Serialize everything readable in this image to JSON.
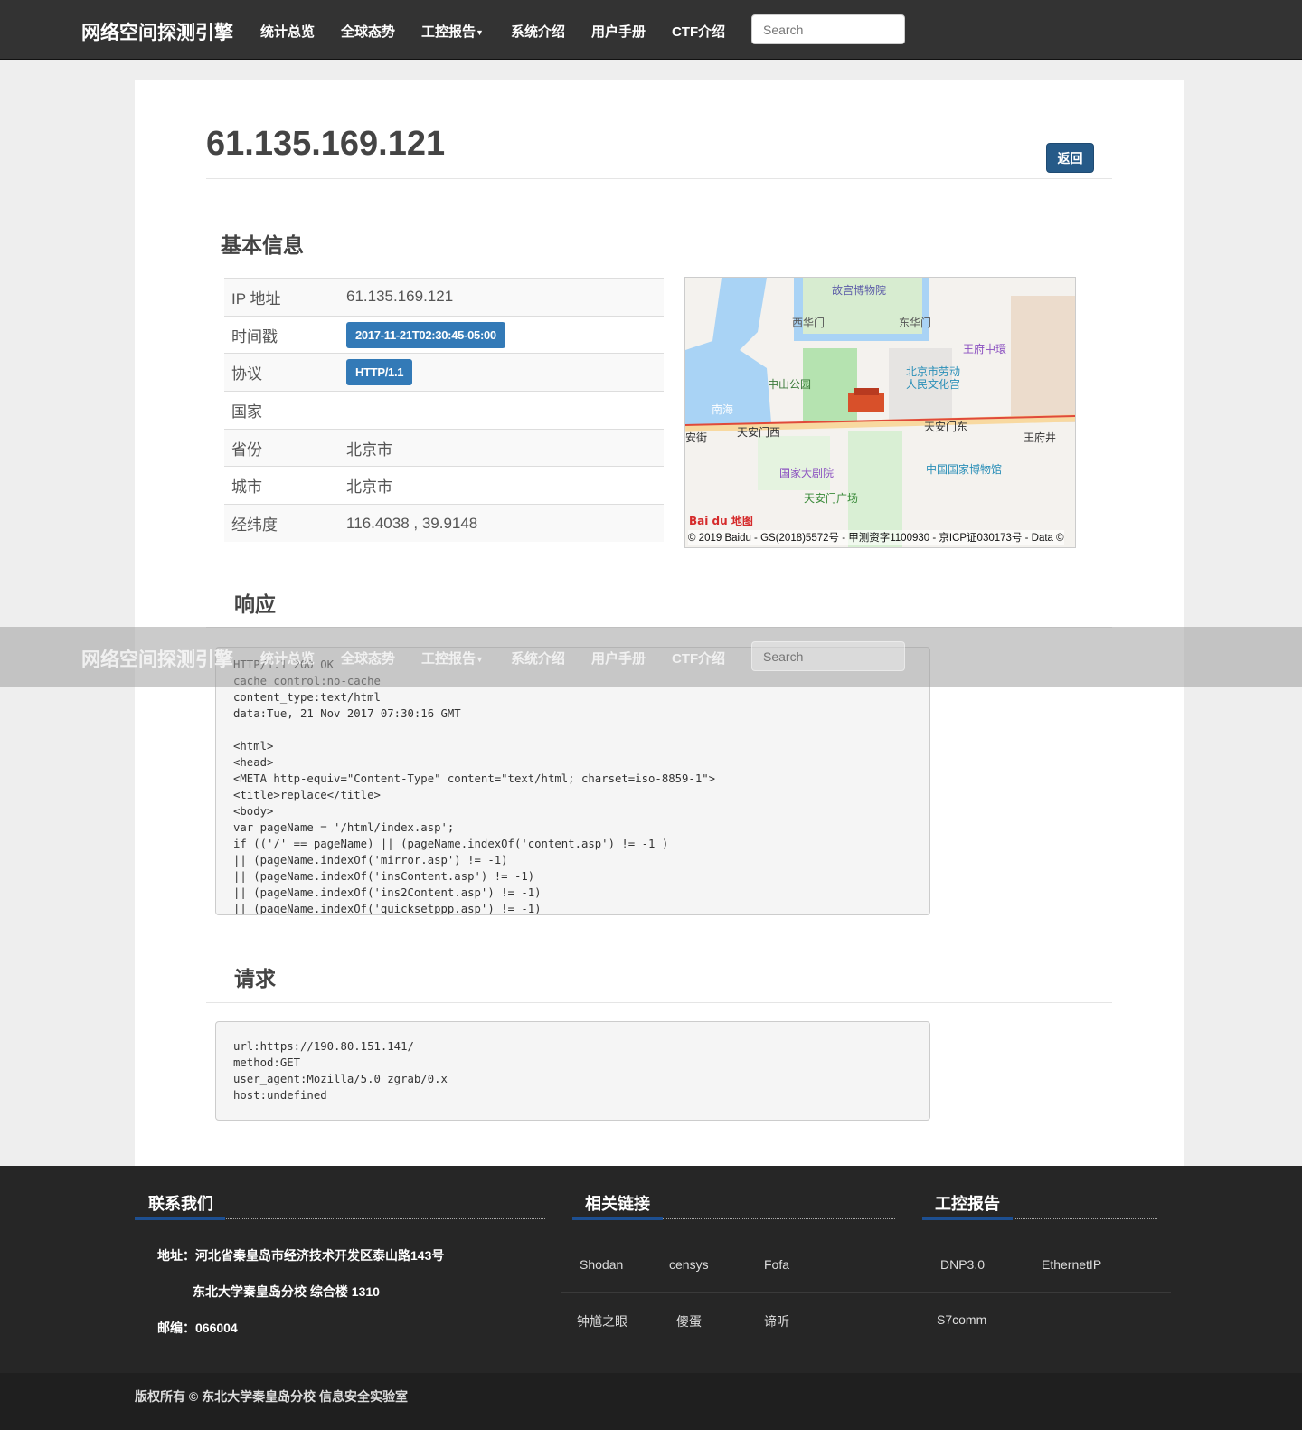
{
  "navbar": {
    "brand": "网络空间探测引擎",
    "items": [
      "统计总览",
      "全球态势",
      "工控报告",
      "系统介绍",
      "用户手册",
      "CTF介绍"
    ],
    "search_placeholder": "Search"
  },
  "page": {
    "title": "61.135.169.121",
    "back_label": "返回"
  },
  "basic": {
    "heading": "基本信息",
    "rows": [
      {
        "label": "IP 地址",
        "value": "61.135.169.121"
      },
      {
        "label": "时间戳",
        "value": "2017-11-21T02:30:45-05:00"
      },
      {
        "label": "协议",
        "value": "HTTP/1.1"
      },
      {
        "label": "国家",
        "value": ""
      },
      {
        "label": "省份",
        "value": "北京市"
      },
      {
        "label": "城市",
        "value": "北京市"
      },
      {
        "label": "经纬度",
        "value": "116.4038 , 39.9148"
      }
    ]
  },
  "map": {
    "labels": [
      "故宫博物院",
      "西华门",
      "东华门",
      "王府中環",
      "北京市劳动",
      "人民文化宫",
      "中山公园",
      "南海",
      "天安门西",
      "天安门东",
      "长安街",
      "王府井",
      "国家大剧院",
      "中国国家博物馆",
      "天安门广场"
    ],
    "logo": "Bai du 地图",
    "copyright": "© 2019 Baidu - GS(2018)5572号 - 甲测资字1100930 - 京ICP证030173号 - Data ©"
  },
  "response": {
    "heading": "响应",
    "body": "HTTP/1.1 200 OK\ncache_control:no-cache\ncontent_type:text/html\ndata:Tue, 21 Nov 2017 07:30:16 GMT\n\n<html>\n<head>\n<META http-equiv=\"Content-Type\" content=\"text/html; charset=iso-8859-1\">\n<title>replace</title>\n<body>\nvar pageName = '/html/index.asp';\nif (('/' == pageName) || (pageName.indexOf('content.asp') != -1 )\n|| (pageName.indexOf('mirror.asp') != -1)\n|| (pageName.indexOf('insContent.asp') != -1)\n|| (pageName.indexOf('ins2Content.asp') != -1)\n|| (pageName.indexOf('quicksetppp.asp') != -1)"
  },
  "request": {
    "heading": "请求",
    "body": "url:https://190.80.151.141/\nmethod:GET\nuser_agent:Mozilla/5.0 zgrab/0.x\nhost:undefined"
  },
  "footer": {
    "contact": {
      "heading": "联系我们",
      "address": "地址：河北省秦皇岛市经济技术开发区泰山路143号",
      "address2": "东北大学秦皇岛分校 综合楼 1310",
      "postcode": "邮编：066004"
    },
    "links": {
      "heading": "相关链接",
      "items": [
        "Shodan",
        "censys",
        "Fofa",
        "钟馗之眼",
        "傻蛋",
        "谛听"
      ]
    },
    "ics": {
      "heading": "工控报告",
      "items": [
        "DNP3.0",
        "EthernetIP",
        "S7comm"
      ]
    },
    "copyright": "版权所有 © 东北大学秦皇岛分校 信息安全实验室"
  },
  "colors": {
    "navbar": "#333333",
    "primary": "#337ab7",
    "footer": "#262626"
  }
}
